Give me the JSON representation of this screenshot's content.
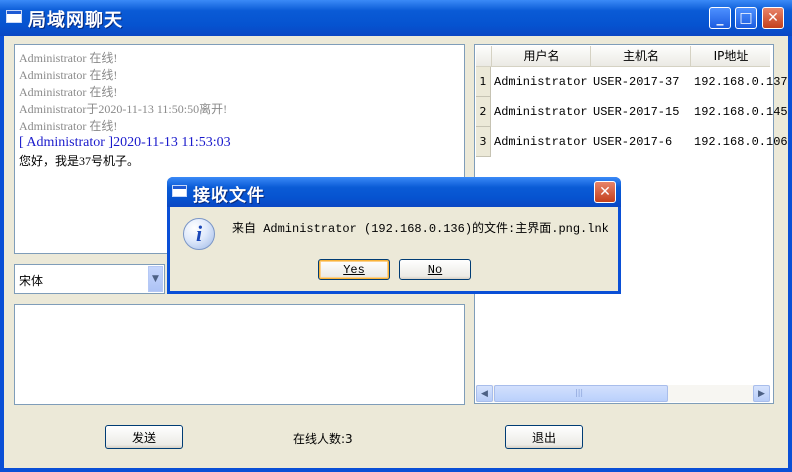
{
  "window": {
    "title": "局域网聊天",
    "minimize": "_",
    "maximize": "□",
    "close": "✕"
  },
  "chat": {
    "lines": [
      "Administrator 在线!",
      "Administrator 在线!",
      "Administrator 在线!",
      "Administrator于2020-11-13 11:50:50离开!",
      "Administrator 在线!"
    ],
    "message_header": "[ Administrator ]2020-11-13 11:53:03",
    "message_body": "您好，我是37号机子。"
  },
  "font_select": {
    "value": "宋体",
    "arrow": "▼"
  },
  "users_table": {
    "columns": [
      "用户名",
      "主机名",
      "IP地址"
    ],
    "rows": [
      {
        "num": "1",
        "username": "Administrator",
        "hostname": "USER-2017-37",
        "ip": "192.168.0.137"
      },
      {
        "num": "2",
        "username": "Administrator",
        "hostname": "USER-2017-15",
        "ip": "192.168.0.145"
      },
      {
        "num": "3",
        "username": "Administrator",
        "hostname": "USER-2017-6",
        "ip": "192.168.0.106"
      }
    ],
    "scroll_left": "◀",
    "scroll_right": "▶",
    "scroll_thumb_grip": "|||"
  },
  "footer": {
    "send_label": "发送",
    "online_count": "在线人数:3",
    "exit_label": "退出"
  },
  "dialog": {
    "title": "接收文件",
    "close": "✕",
    "icon_glyph": "i",
    "message": "来自 Administrator (192.168.0.136)的文件:主界面.png.lnk",
    "yes_label": "Yes",
    "no_label": "No"
  },
  "colors": {
    "title_blue": "#0a4fd6",
    "chat_header_blue": "#1a1acc",
    "chat_system_gray": "#8a8a8a"
  }
}
